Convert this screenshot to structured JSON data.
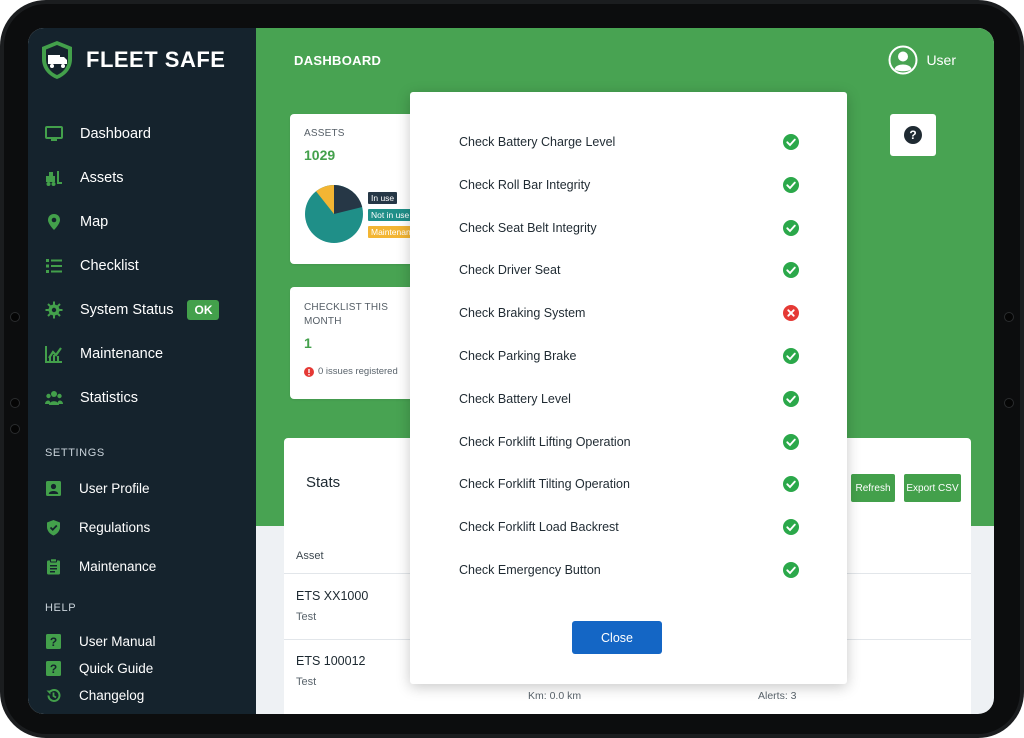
{
  "brand": {
    "name": "FLEET SAFE"
  },
  "nav": [
    {
      "label": "Dashboard",
      "icon": "monitor-icon"
    },
    {
      "label": "Assets",
      "icon": "forklift-icon"
    },
    {
      "label": "Map",
      "icon": "map-pin-icon"
    },
    {
      "label": "Checklist",
      "icon": "list-icon"
    },
    {
      "label": "System Status",
      "icon": "gear-icon",
      "badge": "OK"
    },
    {
      "label": "Maintenance",
      "icon": "chart-icon"
    },
    {
      "label": "Statistics",
      "icon": "users-icon"
    }
  ],
  "settings": {
    "title": "SETTINGS",
    "items": [
      {
        "label": "User Profile",
        "icon": "user-card-icon"
      },
      {
        "label": "Regulations",
        "icon": "shield-check-icon"
      },
      {
        "label": "Maintenance",
        "icon": "clipboard-icon"
      }
    ]
  },
  "help": {
    "title": "HELP",
    "items": [
      {
        "label": "User Manual",
        "icon": "question-icon"
      },
      {
        "label": "Quick Guide",
        "icon": "question-icon"
      },
      {
        "label": "Changelog",
        "icon": "history-icon"
      }
    ]
  },
  "header": {
    "title": "DASHBOARD",
    "user": "User"
  },
  "assets_card": {
    "label": "ASSETS",
    "value": "1029",
    "legend": [
      "In use",
      "Not in use",
      "Maintenance"
    ]
  },
  "checklist_card": {
    "label": "CHECKLIST THIS MONTH",
    "value": "1",
    "issues": "0 issues registered"
  },
  "stats": {
    "title": "Stats",
    "refresh": "Refresh",
    "export": "Export CSV",
    "column": "Asset",
    "rows": [
      {
        "name": "ETS XX1000",
        "sub": "Test"
      },
      {
        "name": "ETS 100012",
        "sub": "Test",
        "km": "Km: 0.0 km",
        "alerts": "Alerts: 3"
      }
    ]
  },
  "modal": {
    "items": [
      {
        "label": "Check Battery Charge Level",
        "ok": true
      },
      {
        "label": "Check Roll Bar Integrity",
        "ok": true
      },
      {
        "label": "Check Seat Belt Integrity",
        "ok": true
      },
      {
        "label": "Check Driver Seat",
        "ok": true
      },
      {
        "label": "Check Braking System",
        "ok": false
      },
      {
        "label": "Check Parking Brake",
        "ok": true
      },
      {
        "label": "Check Battery Level",
        "ok": true
      },
      {
        "label": "Check Forklift Lifting Operation",
        "ok": true
      },
      {
        "label": "Check Forklift Tilting Operation",
        "ok": true
      },
      {
        "label": "Check Forklift Load Backrest",
        "ok": true
      },
      {
        "label": "Check Emergency Button",
        "ok": true
      }
    ],
    "close_label": "Close"
  },
  "colors": {
    "sidebar": "#15232d",
    "accent_green": "#48a352",
    "pass": "#2ba84a",
    "fail": "#e53935",
    "primary_blue": "#1466c5"
  }
}
